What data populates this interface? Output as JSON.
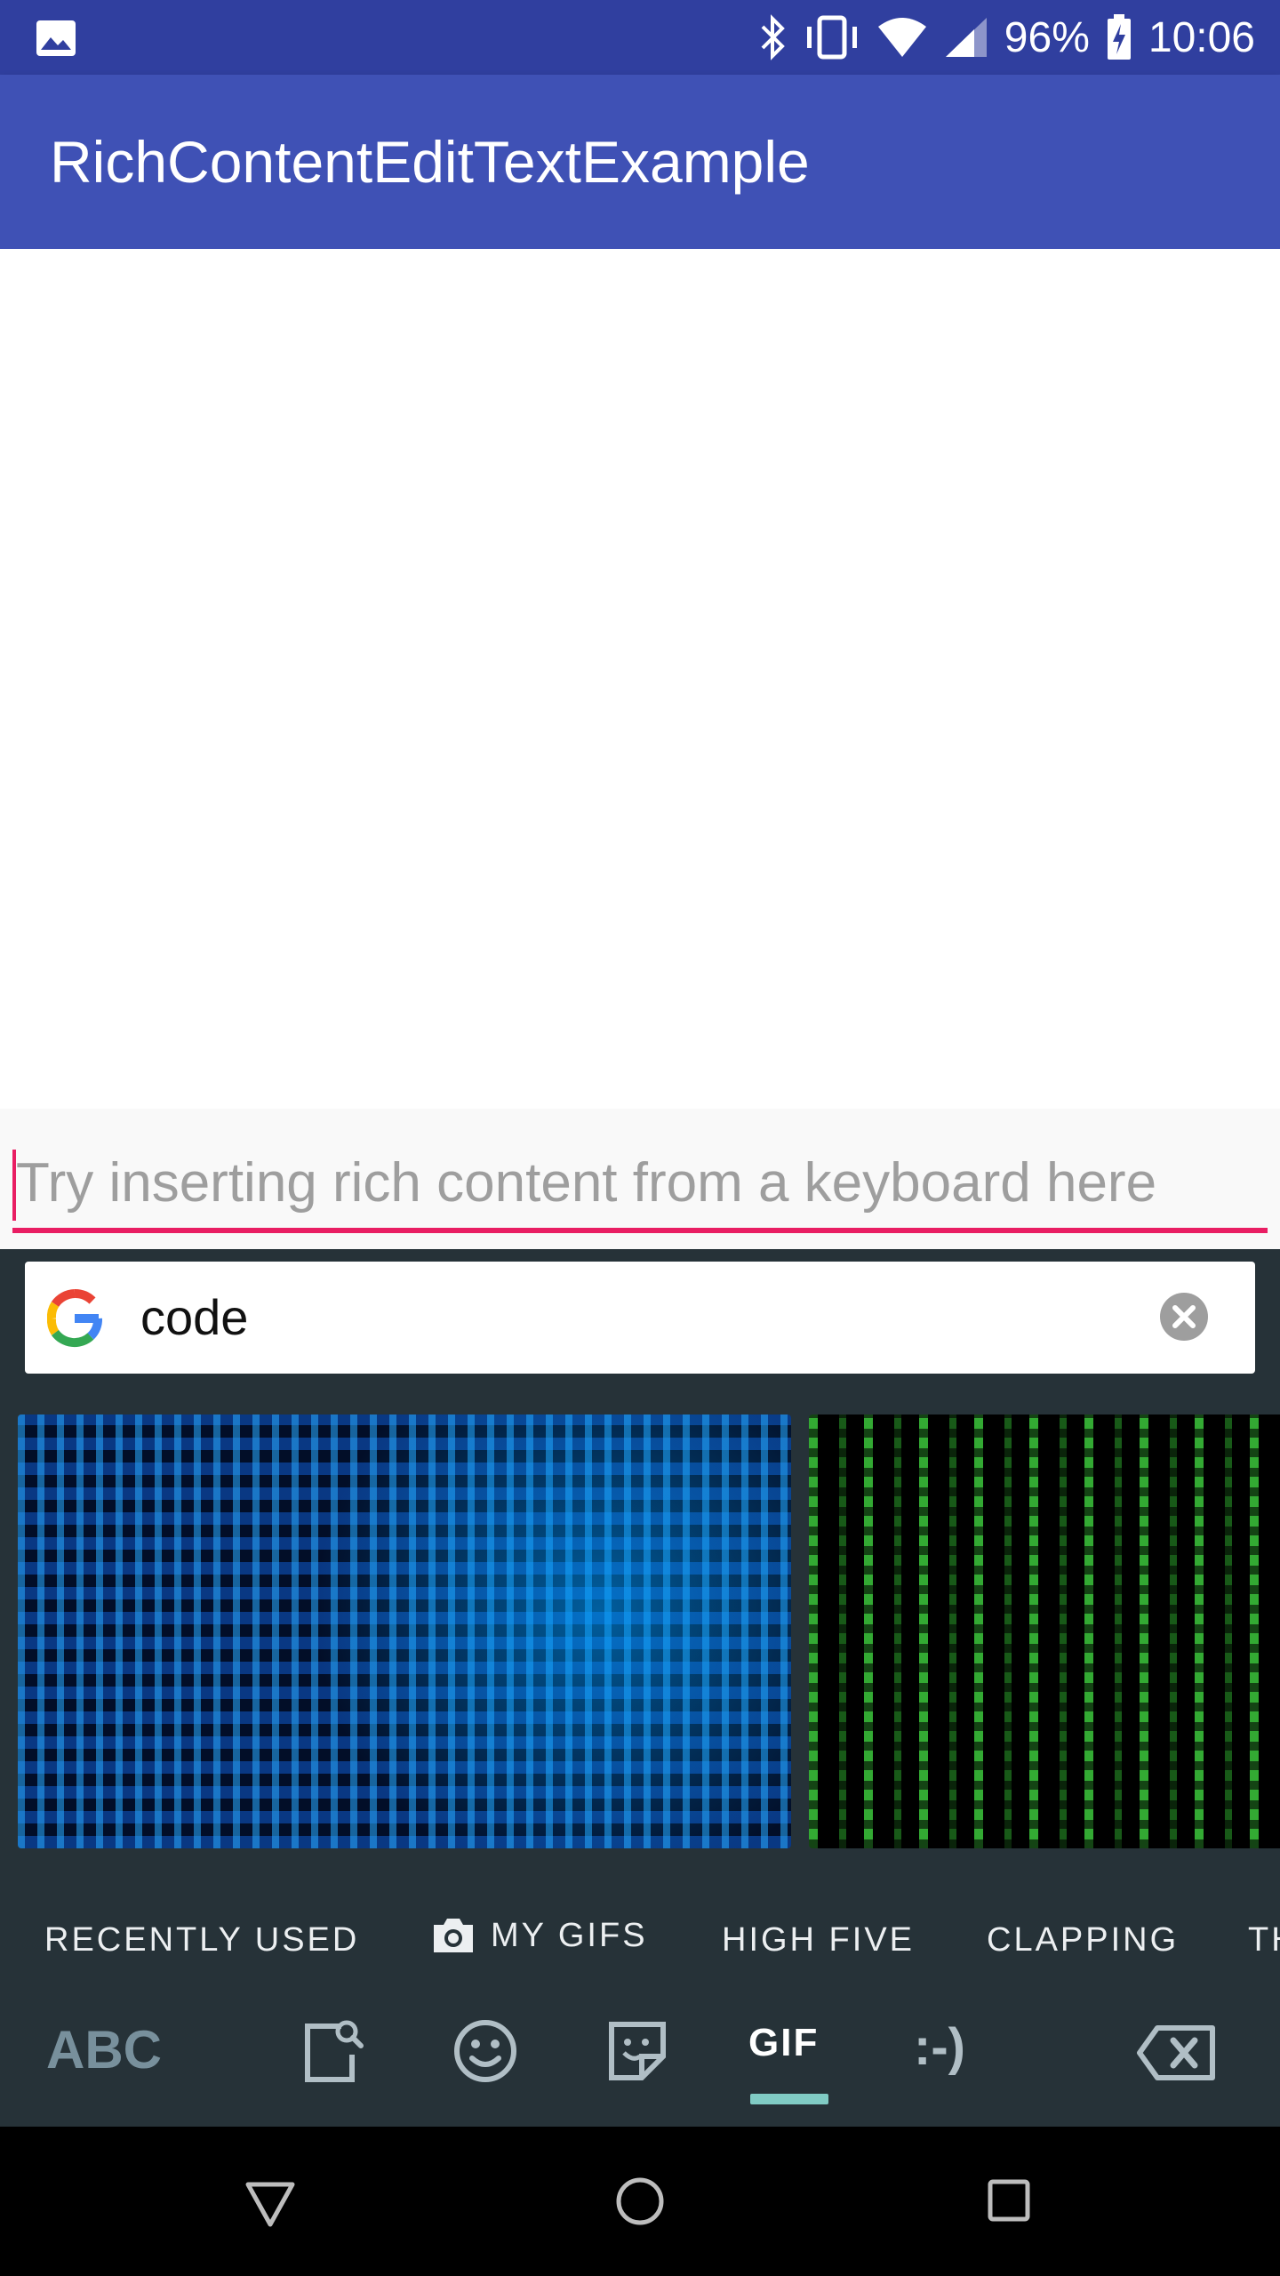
{
  "status_bar": {
    "battery_percent": "96%",
    "time": "10:06"
  },
  "app_bar": {
    "title": "RichContentEditTextExample"
  },
  "edit_text": {
    "hint": "Try inserting rich content from a keyboard here"
  },
  "keyboard": {
    "search": {
      "value": "code"
    },
    "gif_results": [
      {
        "name": "blue binary code gif"
      },
      {
        "name": "green matrix code gif"
      }
    ],
    "categories": [
      {
        "label": "RECENTLY USED"
      },
      {
        "label": "MY GIFS",
        "icon": "camera-icon"
      },
      {
        "label": "HIGH FIVE"
      },
      {
        "label": "CLAPPING"
      },
      {
        "label": "TH"
      }
    ],
    "toolbar": {
      "abc_label": "ABC",
      "gif_label": "GIF",
      "emoticon_label": ":-)"
    }
  },
  "colors": {
    "status_bar": "#303f9f",
    "app_bar": "#3f51b5",
    "accent": "#e91e63",
    "keyboard_bg": "#263238",
    "gif_tab_indicator": "#80cbc4"
  }
}
